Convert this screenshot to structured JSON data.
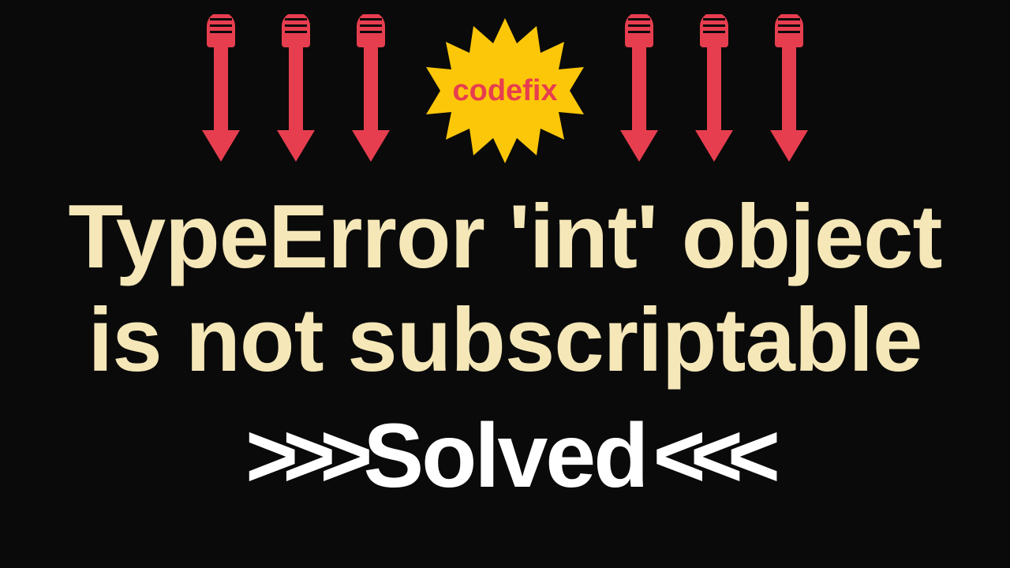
{
  "badge": {
    "text": "codefix"
  },
  "error": {
    "line1": "TypeError 'int' object",
    "line2": "is not subscriptable"
  },
  "status": {
    "chevron_left": ">>>",
    "word": "Solved",
    "chevron_right": "<<<"
  },
  "colors": {
    "background": "#0a0a0a",
    "arrows": "#e73e4f",
    "starburst": "#fdc709",
    "badge_text": "#e73e4f",
    "error_text": "#f5e7b8",
    "solved_text": "#ffffff"
  }
}
